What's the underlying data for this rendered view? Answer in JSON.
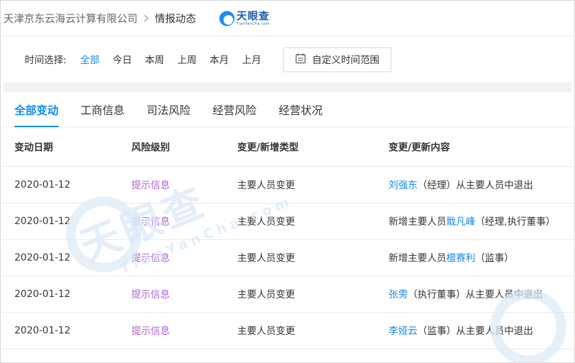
{
  "breadcrumb": {
    "company": "天津京东云海云计算有限公司",
    "current": "情报动态"
  },
  "logo": {
    "text": "天眼查",
    "sub": "TianYanCha.com"
  },
  "time_filter": {
    "label": "时间选择:",
    "options": [
      "全部",
      "今日",
      "本周",
      "上周",
      "本月",
      "上月"
    ],
    "selected": "全部",
    "custom_range_label": "自定义时间范围"
  },
  "tabs": [
    "全部变动",
    "工商信息",
    "司法风险",
    "经营风险",
    "经营状况"
  ],
  "active_tab": "全部变动",
  "table": {
    "columns": [
      "变动日期",
      "风险级别",
      "变更/新增类型",
      "变更/更新内容"
    ],
    "rows": [
      {
        "date": "2020-01-12",
        "risk": "提示信息",
        "type": "主要人员变更",
        "prefix": "",
        "name": "刘强东",
        "suffix": "（经理）从主要人员中退出"
      },
      {
        "date": "2020-01-12",
        "risk": "提示信息",
        "type": "主要人员变更",
        "prefix": "新增主要人员",
        "name": "戢凡峰",
        "suffix": "（经理,执行董事）"
      },
      {
        "date": "2020-01-12",
        "risk": "提示信息",
        "type": "主要人员变更",
        "prefix": "新增主要人员",
        "name": "檀赛利",
        "suffix": "（监事）"
      },
      {
        "date": "2020-01-12",
        "risk": "提示信息",
        "type": "主要人员变更",
        "prefix": "",
        "name": "张雱",
        "suffix": "（执行董事）从主要人员中退出"
      },
      {
        "date": "2020-01-12",
        "risk": "提示信息",
        "type": "主要人员变更",
        "prefix": "",
        "name": "李娅云",
        "suffix": "（监事）从主要人员中退出"
      }
    ]
  },
  "watermark": {
    "text": "天眼查",
    "sub": "TianYanCha.com"
  },
  "colors": {
    "accent": "#128bed",
    "risk": "#b263d4",
    "logo": "#1a5fb4"
  },
  "icons": {
    "breadcrumb_separator": "chevron-right-icon",
    "custom_range": "calendar-icon",
    "logo": "tianyancha-logo-icon"
  }
}
